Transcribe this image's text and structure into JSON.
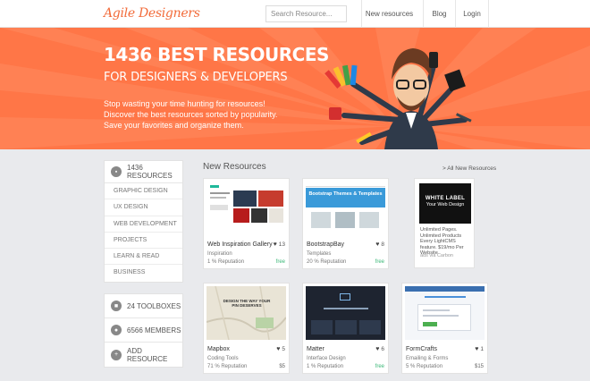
{
  "header": {
    "logo": "Agile Designers",
    "search_placeholder": "Search Resource...",
    "nav": [
      "New resources",
      "Blog",
      "Login"
    ]
  },
  "hero": {
    "title": "1436 BEST RESOURCES",
    "subtitle": "FOR DESIGNERS & DEVELOPERS",
    "lines": [
      "Stop wasting your time hunting for resources!",
      "Discover the best resources sorted by popularity.",
      "Save your favorites and organize them."
    ]
  },
  "sidebar": {
    "resources_label": "1436 RESOURCES",
    "categories": [
      "GRAPHIC DESIGN",
      "UX DESIGN",
      "WEB DEVELOPMENT",
      "PROJECTS",
      "LEARN & READ",
      "BUSINESS"
    ],
    "stats": [
      {
        "label": "24 TOOLBOXES",
        "icon": "toolbox-icon"
      },
      {
        "label": "6566 MEMBERS",
        "icon": "members-icon"
      },
      {
        "label": "ADD RESOURCE",
        "icon": "add-icon"
      }
    ]
  },
  "main": {
    "section_title": "New Resources",
    "all_link": "> All New Resources",
    "cards": [
      {
        "name": "Web Inspiration Gallery",
        "category": "Inspiration",
        "reputation": "1 % Reputation",
        "likes": "13",
        "price": "free",
        "free": true
      },
      {
        "name": "BootstrapBay",
        "category": "Templates",
        "reputation": "20 % Reputation",
        "likes": "8",
        "price": "free",
        "free": true,
        "thumb_text": "Bootstrap Themes & Templates"
      },
      {
        "name": "Mapbox",
        "category": "Coding Tools",
        "reputation": "71 % Reputation",
        "likes": "5",
        "price": "$5",
        "free": false,
        "thumb_text": "DESIGN THE WAY YOUR PIN DESERVES"
      },
      {
        "name": "Matter",
        "category": "Interface Design",
        "reputation": "1 % Reputation",
        "likes": "6",
        "price": "free",
        "free": true
      },
      {
        "name": "FormCrafts",
        "category": "Emailing & Forms",
        "reputation": "5 % Reputation",
        "likes": "1",
        "price": "$15",
        "free": false
      }
    ],
    "ad": {
      "img_line1": "WHITE LABEL",
      "img_line2": "Your Web Design",
      "text": "Unlimited Pages. Unlimited Products Every LightCMS feature. $19/mo Per Website",
      "via": "ads via Carbon"
    }
  },
  "colors": {
    "accent": "#ff7647",
    "logo": "#f26b3a",
    "free": "#3cb878"
  }
}
